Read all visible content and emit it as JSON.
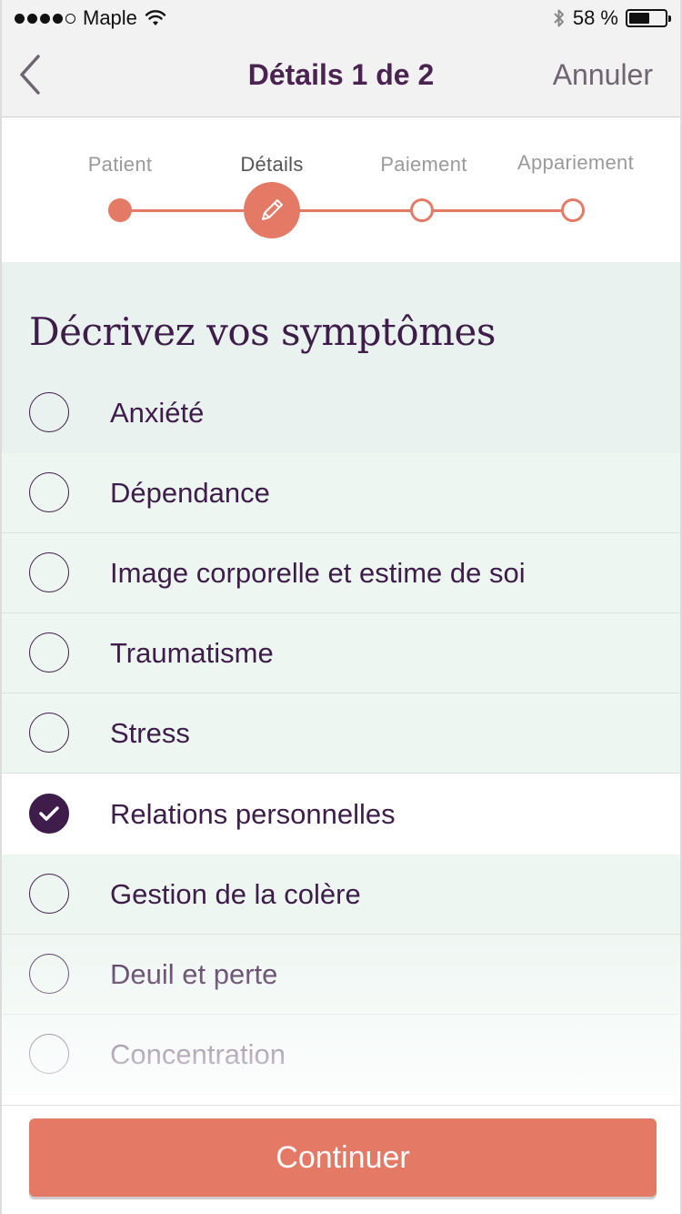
{
  "status_bar": {
    "carrier": "Maple",
    "battery_text": "58 %",
    "battery_level": 0.58,
    "icons": [
      "signal-dots-icon",
      "wifi-icon",
      "bluetooth-icon",
      "battery-icon"
    ]
  },
  "nav": {
    "back_icon": "chevron-left-icon",
    "title": "Détails 1 de 2",
    "cancel_label": "Annuler"
  },
  "stepper": {
    "steps": [
      {
        "label": "Patient",
        "state": "done"
      },
      {
        "label": "Détails",
        "state": "active",
        "icon": "pencil-icon"
      },
      {
        "label": "Paiement",
        "state": "pending"
      },
      {
        "label": "Appariement",
        "state": "pending"
      }
    ]
  },
  "symptoms": {
    "title": "Décrivez vos symptômes",
    "items": [
      {
        "label": "Anxiété",
        "checked": false
      },
      {
        "label": "Dépendance",
        "checked": false
      },
      {
        "label": "Image corporelle et estime de soi",
        "checked": false
      },
      {
        "label": "Traumatisme",
        "checked": false
      },
      {
        "label": "Stress",
        "checked": false
      },
      {
        "label": "Relations personnelles",
        "checked": true
      },
      {
        "label": "Gestion de la colère",
        "checked": false
      },
      {
        "label": "Deuil et perte",
        "checked": false
      },
      {
        "label": "Concentration",
        "checked": false
      }
    ]
  },
  "footer": {
    "continue_label": "Continuer"
  },
  "colors": {
    "accent": "#e47a65",
    "primary": "#3e1d4a",
    "row_bg": "#eef6f2"
  }
}
